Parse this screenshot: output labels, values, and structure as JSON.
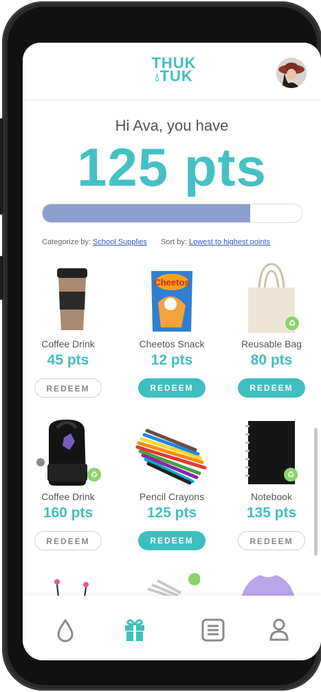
{
  "app": {
    "logo_line1": "THUK",
    "logo_line2": "TUK"
  },
  "user": {
    "greeting": "Hi Ava, you have",
    "points": "125 pts",
    "progress_fraction": 0.8
  },
  "filters": {
    "categorize_label": "Categorize by:",
    "categorize_value": "School Supplies",
    "sort_label": "Sort by:",
    "sort_value": "Lowest to highest points"
  },
  "products": [
    {
      "name": "Coffee Drink",
      "points": "45 pts",
      "button": "REDEEM",
      "redeemable": false,
      "icon": "coffee-cup"
    },
    {
      "name": "Cheetos Snack",
      "points": "12 pts",
      "button": "REDEEM",
      "redeemable": true,
      "icon": "snack-bag"
    },
    {
      "name": "Reusable Bag",
      "points": "80 pts",
      "button": "REDEEM",
      "redeemable": true,
      "icon": "tote-bag"
    },
    {
      "name": "Coffee Drink",
      "points": "160 pts",
      "button": "REDEEM",
      "redeemable": false,
      "icon": "backpack"
    },
    {
      "name": "Pencil Crayons",
      "points": "125 pts",
      "button": "REDEEM",
      "redeemable": true,
      "icon": "pencil-crayons"
    },
    {
      "name": "Notebook",
      "points": "135 pts",
      "button": "REDEEM",
      "redeemable": false,
      "icon": "notebook"
    }
  ],
  "nav": [
    {
      "icon": "drop-icon",
      "active": false
    },
    {
      "icon": "gift-icon",
      "active": true
    },
    {
      "icon": "list-icon",
      "active": false
    },
    {
      "icon": "person-icon",
      "active": false
    }
  ],
  "colors": {
    "accent": "#3fbfbf",
    "progress": "#8c9fcc",
    "link": "#2d5dbf"
  }
}
